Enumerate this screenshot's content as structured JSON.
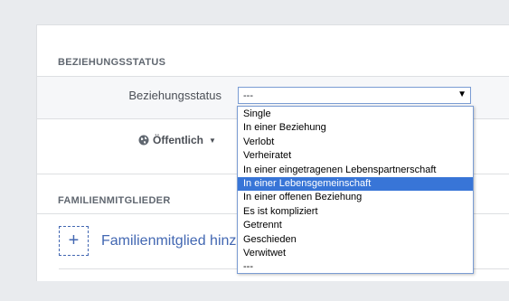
{
  "sections": {
    "relationship_heading": "BEZIEHUNGSSTATUS",
    "family_heading": "FAMILIENMITGLIEDER"
  },
  "relationship": {
    "field_label": "Beziehungsstatus",
    "selected_value": "---",
    "privacy_label": "Öffentlich",
    "options": [
      "Single",
      "In einer Beziehung",
      "Verlobt",
      "Verheiratet",
      "In einer eingetragenen Lebenspartnerschaft",
      "In einer Lebensgemeinschaft",
      "In einer offenen Beziehung",
      "Es ist kompliziert",
      "Getrennt",
      "Geschieden",
      "Verwitwet",
      "---"
    ],
    "highlighted_option": "In einer Lebensgemeinschaft"
  },
  "family": {
    "add_label": "Familienmitglied hinzufügen"
  },
  "colors": {
    "accent": "#4267b2",
    "highlight": "#3875d7",
    "page_bg": "#e9ebee"
  }
}
